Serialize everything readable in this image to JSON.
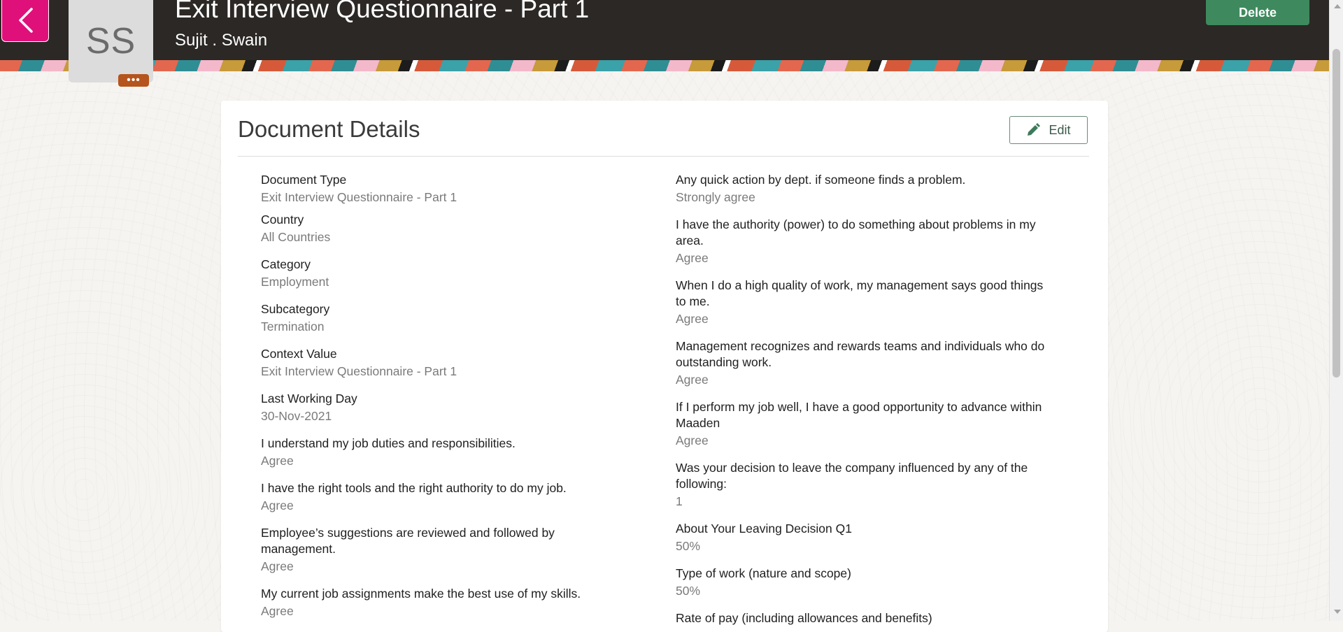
{
  "header": {
    "title": "Exit Interview Questionnaire - Part 1",
    "person_name": "Sujit . Swain",
    "avatar_initials": "SS",
    "more_label": "•••",
    "delete_label": "Delete"
  },
  "colors": {
    "back_button": "#e0107a",
    "delete_button": "#3e8a5e",
    "header_bg": "#2b2825",
    "avatar_more": "#b5541c"
  },
  "icons": {
    "back": "chevron-left-icon",
    "edit": "pencil-icon"
  },
  "card": {
    "title": "Document Details",
    "edit_label": "Edit",
    "left_fields": [
      {
        "label": "Document Type",
        "value": "Exit Interview Questionnaire - Part 1"
      },
      {
        "label": "Country",
        "value": "All Countries"
      },
      {
        "label": "Category",
        "value": "Employment"
      },
      {
        "label": "Subcategory",
        "value": "Termination"
      },
      {
        "label": "Context Value",
        "value": "Exit Interview Questionnaire - Part 1"
      },
      {
        "label": "Last Working Day",
        "value": "30-Nov-2021"
      },
      {
        "label": "I understand my job duties and responsibilities.",
        "value": "Agree"
      },
      {
        "label": "I have the right tools and the right authority to do my job.",
        "value": "Agree"
      },
      {
        "label": "Employee’s suggestions are reviewed and followed by management.",
        "value": "Agree"
      },
      {
        "label": "My current job assignments make the best use of my skills.",
        "value": "Agree"
      }
    ],
    "right_fields": [
      {
        "label": "Any quick action by dept. if someone finds a problem.",
        "value": "Strongly agree"
      },
      {
        "label": "I have the authority (power) to do something about problems in my area.",
        "value": "Agree"
      },
      {
        "label": "When I do a high quality of work, my management says good things to me.",
        "value": "Agree"
      },
      {
        "label": "Management recognizes and rewards teams and individuals who do outstanding work.",
        "value": "Agree"
      },
      {
        "label": "If I perform my job well, I have a good opportunity to advance within Maaden",
        "value": "Agree"
      },
      {
        "label": "Was your decision to leave the company influenced by any of the following:",
        "value": "1"
      },
      {
        "label": "About Your Leaving Decision Q1",
        "value": "50%"
      },
      {
        "label": "Type of work (nature and scope)",
        "value": "50%"
      },
      {
        "label": "Rate of pay (including allowances and benefits)",
        "value": ""
      }
    ]
  }
}
